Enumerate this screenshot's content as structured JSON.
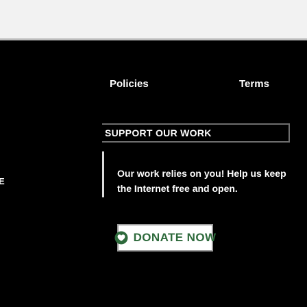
{
  "footer": {
    "links": {
      "policies": "Policies",
      "terms": "Terms"
    }
  },
  "support": {
    "heading": "SUPPORT OUR WORK",
    "clipped_letter": "E",
    "body": "Our work relies on you! Help us keep the Internet free and open.",
    "donate_button": {
      "label": "DONATE NOW",
      "icon": "heart-icon"
    }
  },
  "colors": {
    "background": "#000000",
    "top_strip": "#f2f2f2",
    "text": "#ffffff",
    "donate_text": "#2e6a3c",
    "border": "#6e6e6e"
  }
}
